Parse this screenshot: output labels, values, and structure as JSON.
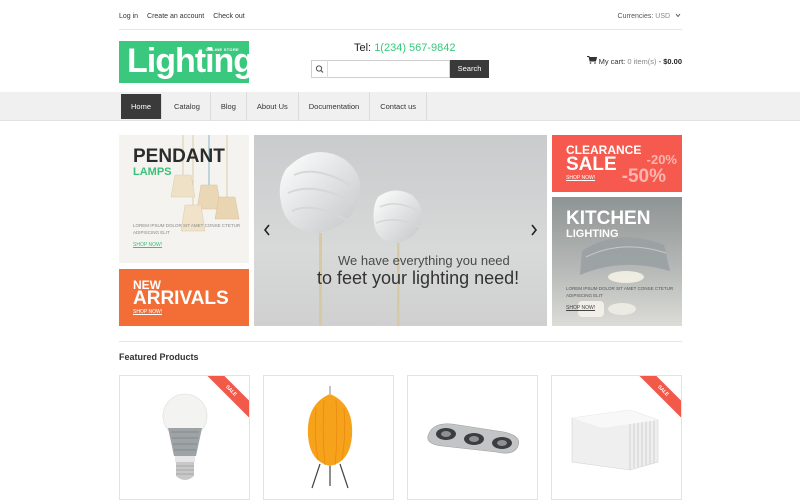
{
  "topbar": {
    "links": [
      "Log in",
      "Create an account",
      "Check out"
    ],
    "currency_label": "Currencies:",
    "currency_value": "USD"
  },
  "logo": {
    "word": "Lighting",
    "tagline": "ONLINE STORE"
  },
  "header": {
    "phone_label": "Tel:",
    "phone_number": "1(234) 567-9842",
    "search_placeholder": "",
    "search_button": "Search",
    "cart_label": "My cart:",
    "cart_items": "0 item(s)",
    "cart_total": "$0.00"
  },
  "nav": {
    "items": [
      {
        "label": "Home",
        "active": true
      },
      {
        "label": "Catalog",
        "active": false
      },
      {
        "label": "Blog",
        "active": false
      },
      {
        "label": "About Us",
        "active": false
      },
      {
        "label": "Documentation",
        "active": false
      },
      {
        "label": "Contact us",
        "active": false
      }
    ]
  },
  "banners": {
    "pendant": {
      "title": "PENDANT",
      "subtitle": "LAMPS",
      "desc": "LOREM IPSUM DOLOR SIT AMET CONSE CTETUR ADIPISCING ELIT",
      "cta": "SHOP NOW!"
    },
    "arrivals": {
      "line1": "NEW",
      "line2": "ARRIVALS",
      "cta": "SHOP NOW!"
    },
    "slider": {
      "line1": "We have everything you need",
      "line2": "to feet your lighting need!"
    },
    "clearance": {
      "line1": "CLEARANCE",
      "line2": "SALE",
      "pct1": "-20%",
      "pct2": "-50%",
      "cta": "SHOP NOW!"
    },
    "kitchen": {
      "title": "KITCHEN",
      "subtitle": "LIGHTING",
      "desc": "LOREM IPSUM DOLOR SIT AMET CONSE CTETUR ADIPISCING ELIT",
      "cta": "SHOP NOW!"
    }
  },
  "featured": {
    "heading": "Featured Products",
    "products": [
      {
        "icon": "led-bulb-image",
        "badge": "SALE"
      },
      {
        "icon": "paper-lamp-image",
        "badge": ""
      },
      {
        "icon": "spotlight-bar-image",
        "badge": ""
      },
      {
        "icon": "wall-lamp-image",
        "badge": "SALE"
      }
    ]
  },
  "colors": {
    "accent_green": "#39c87d",
    "orange": "#f26e36",
    "red": "#f65a4e",
    "dark": "#3a3a3a"
  }
}
